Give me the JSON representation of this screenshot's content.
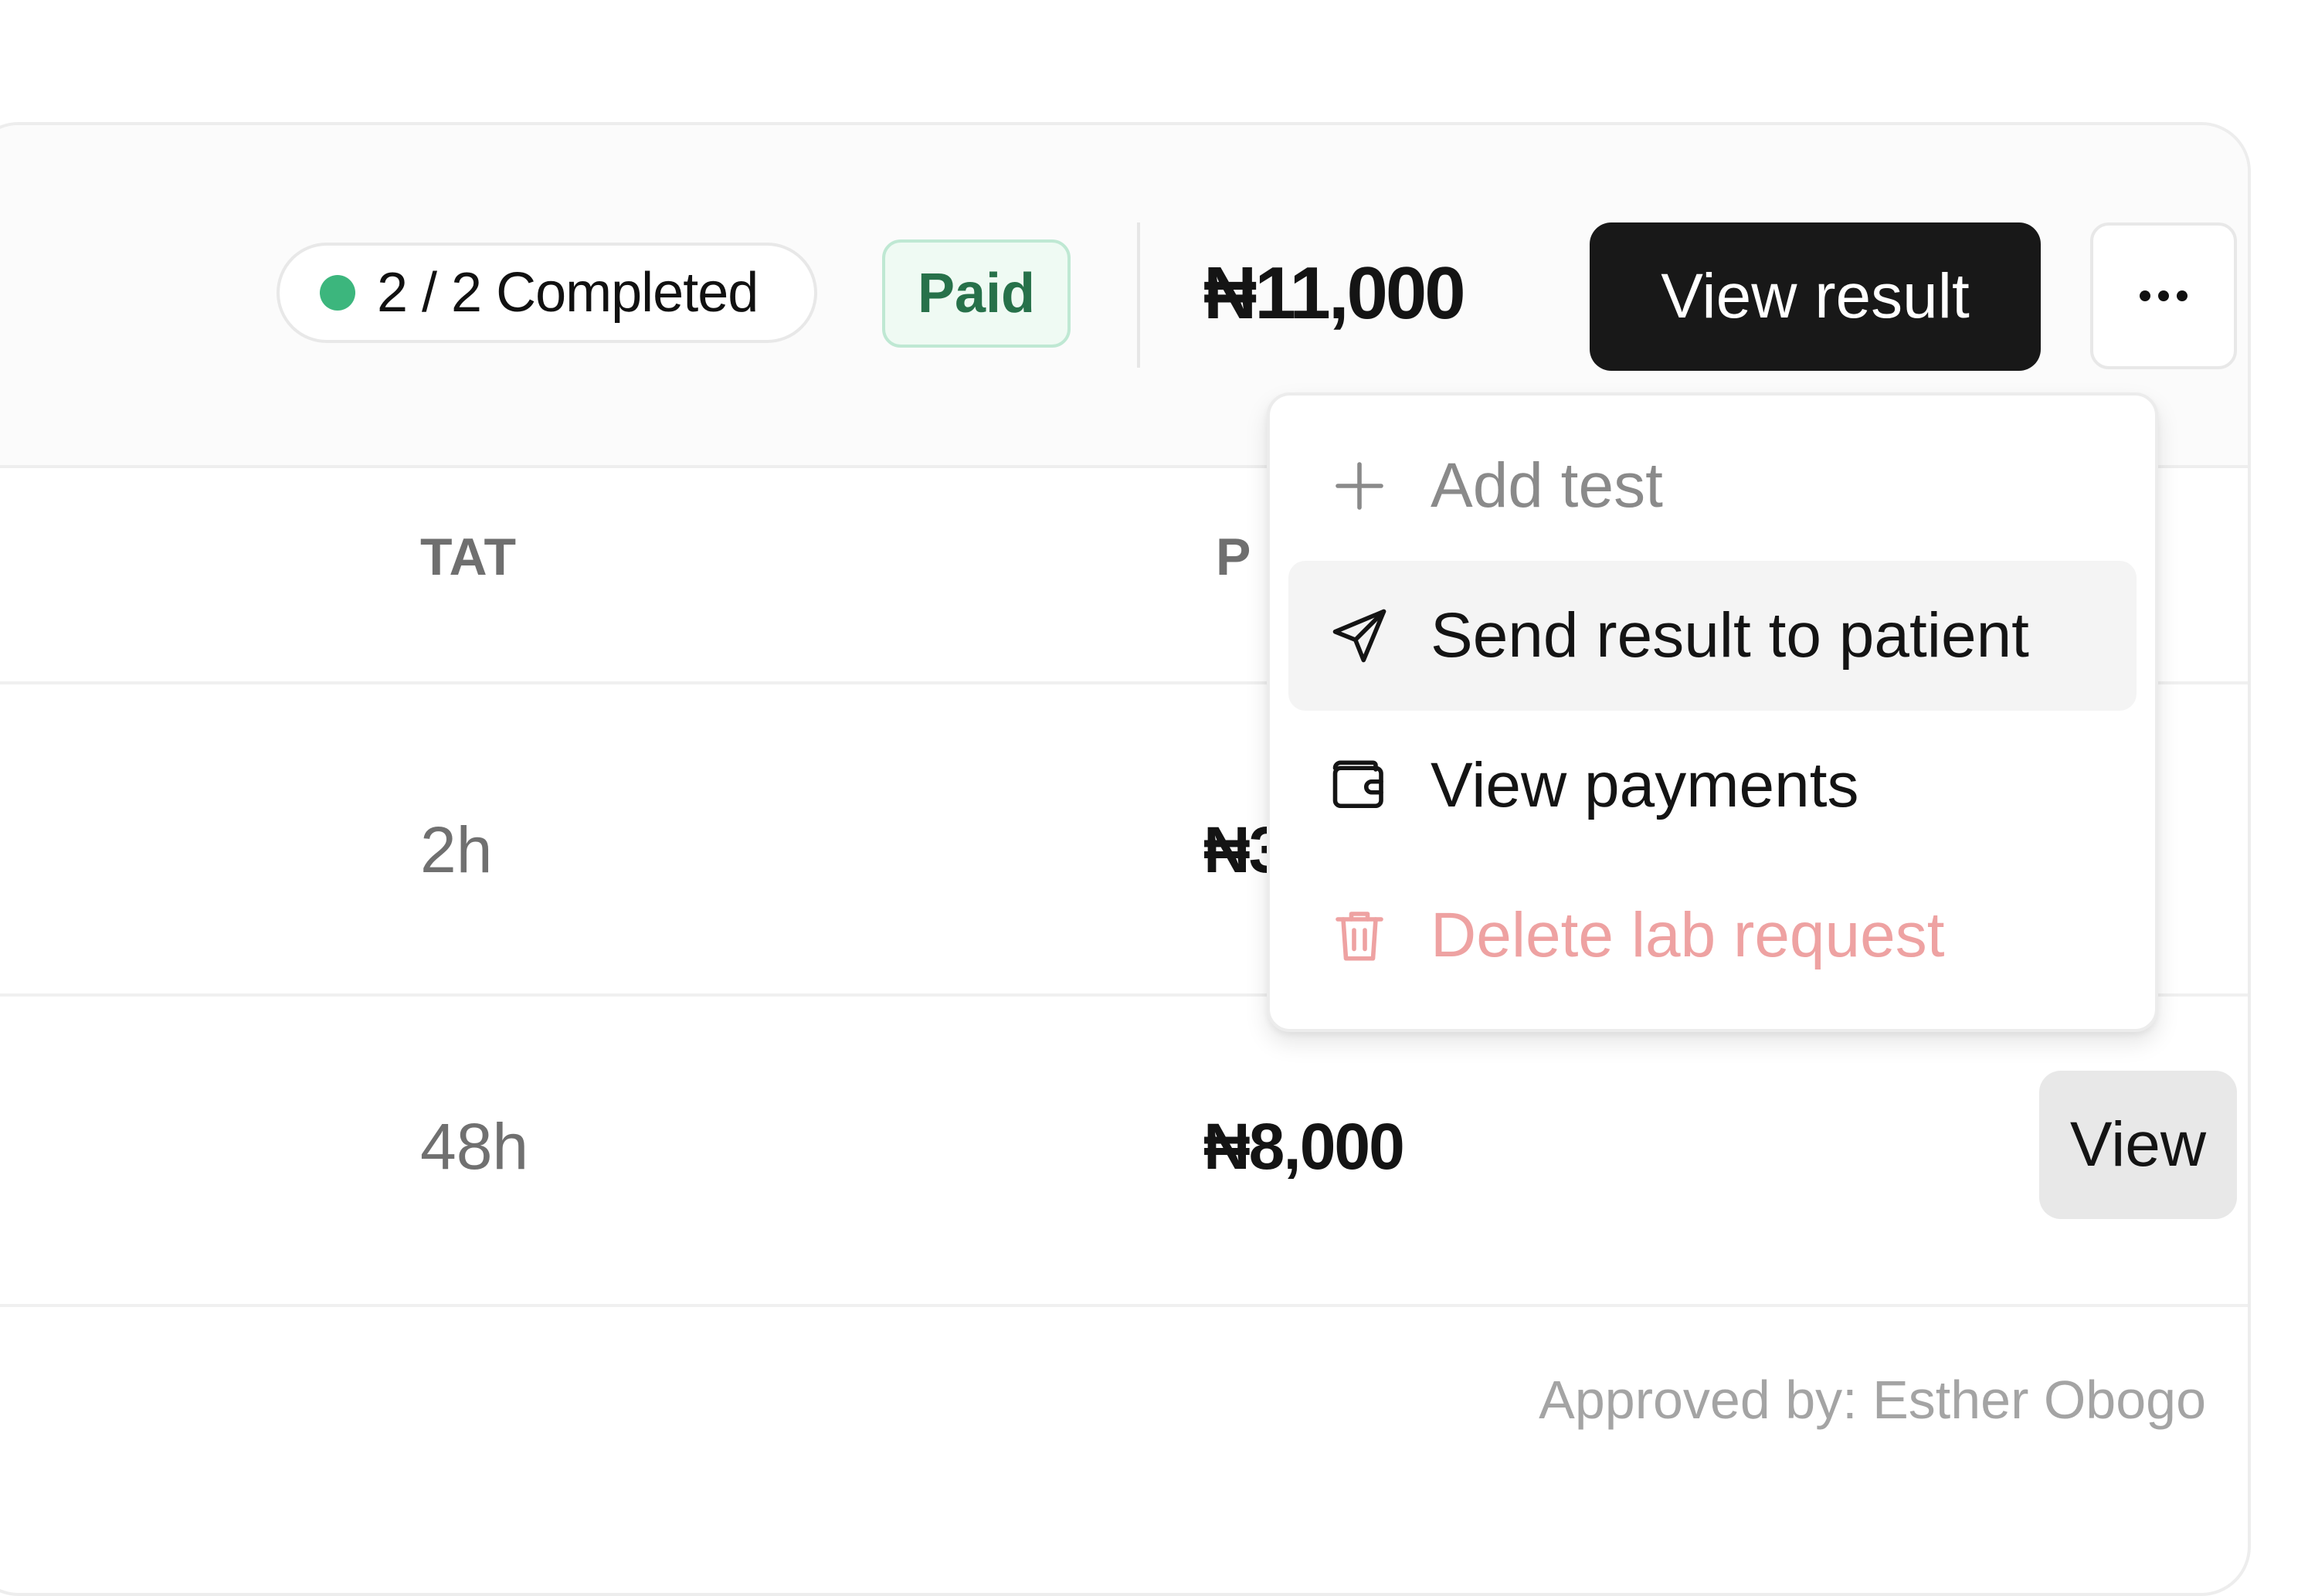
{
  "order": {
    "status_label": "2 / 2 Completed",
    "status_color": "#3cb67d",
    "payment_badge": "Paid",
    "total_price": "₦11,000",
    "view_result_label": "View result",
    "more_icon": "ellipsis-horizontal-icon"
  },
  "table": {
    "columns": [
      "TAT",
      "P"
    ],
    "rows": [
      {
        "tat": "2h",
        "price": "₦3"
      },
      {
        "tat": "48h",
        "price": "₦8,000",
        "action": "View"
      }
    ]
  },
  "footer": {
    "approved_by": "Approved by: Esther Obogo"
  },
  "dropdown": {
    "items": [
      {
        "label": "Add test",
        "icon": "plus-icon",
        "state": "disabled"
      },
      {
        "label": "Send result to patient",
        "icon": "send-icon",
        "state": "hovered"
      },
      {
        "label": "View payments",
        "icon": "wallet-icon",
        "state": "normal"
      },
      {
        "label": "Delete lab request",
        "icon": "trash-icon",
        "state": "danger"
      }
    ]
  },
  "colors": {
    "primary_button": "#181818",
    "paid_text": "#27714a",
    "paid_bg": "#effaf3",
    "danger": "#eea2a2"
  }
}
